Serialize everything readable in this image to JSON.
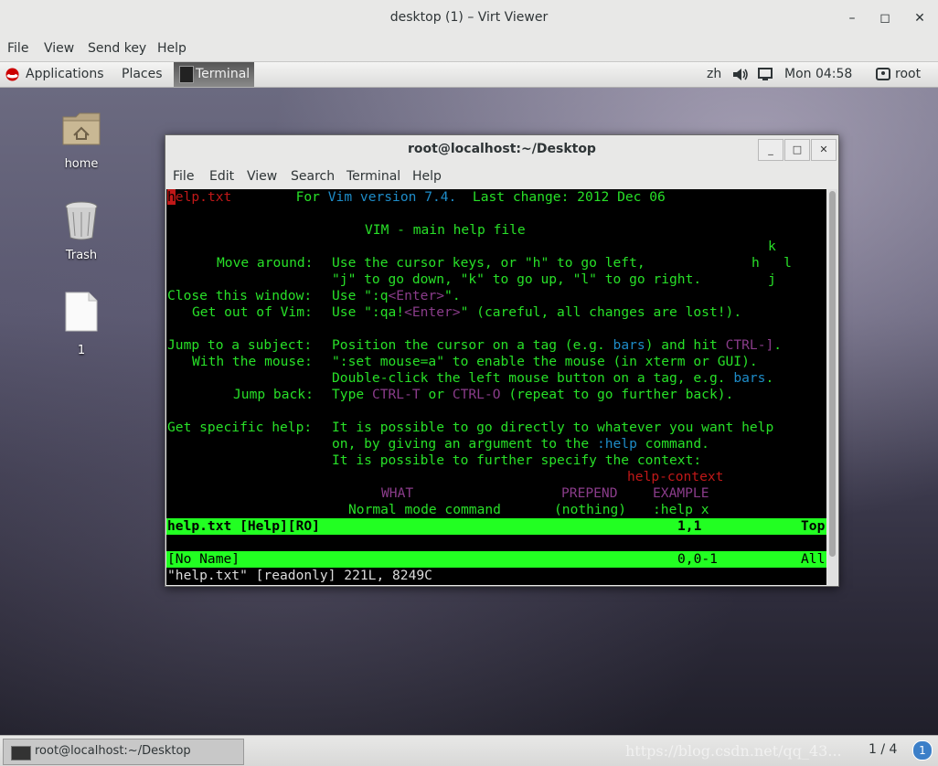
{
  "outer_window": {
    "title": "desktop (1) – Virt Viewer",
    "controls": {
      "minimize": "–",
      "maximize": "◻",
      "close": "✕"
    },
    "menu": [
      "File",
      "View",
      "Send key",
      "Help"
    ]
  },
  "guest_panel": {
    "applications": "Applications",
    "places": "Places",
    "terminal_tab": "Terminal",
    "input_method": "zh",
    "clock": "Mon 04:58",
    "user": "root"
  },
  "desktop_icons": [
    {
      "label": "home",
      "icon": "home-folder-icon"
    },
    {
      "label": "Trash",
      "icon": "trash-icon"
    },
    {
      "label": "1",
      "icon": "file-icon"
    }
  ],
  "terminal": {
    "title": "root@localhost:~/Desktop",
    "menu": [
      "File",
      "Edit",
      "View",
      "Search",
      "Terminal",
      "Help"
    ],
    "lines": {
      "l1_cursor": "h",
      "l1_file": "elp.txt",
      "l1_for": "For ",
      "l1_vim": "Vim version 7.4.",
      "l1_change": "  Last change: 2012 Dec 06",
      "l3": "VIM - main help file",
      "l4_k": "k",
      "l5_label": "Move around:",
      "l5_text": "Use the cursor keys, or \"h\" to go left,",
      "l5_hl": "h   l",
      "l6_text": "\"j\" to go down, \"k\" to go up, \"l\" to go right.",
      "l6_j": "j",
      "l7_label": "Close this window:",
      "l7_a": "Use \":q",
      "l7_enter": "<Enter>",
      "l7_b": "\".",
      "l8_label": "Get out of Vim:",
      "l8_a": "Use \":qa!",
      "l8_enter": "<Enter>",
      "l8_b": "\" (careful, all changes are lost!).",
      "l10_label": "Jump to a subject:",
      "l10_a": "Position the cursor on a tag (e.g. ",
      "l10_bars": "bars",
      "l10_b": ") and hit ",
      "l10_ctrl": "CTRL-]",
      "l10_c": ".",
      "l11_label": "With the mouse:",
      "l11_text": "\":set mouse=a\" to enable the mouse (in xterm or GUI).",
      "l12_a": "Double-click the left mouse button on a tag, e.g. ",
      "l12_bars": "bars",
      "l12_b": ".",
      "l13_label": "Jump back:",
      "l13_a": "Type ",
      "l13_ctrlt": "CTRL-T",
      "l13_b": " or ",
      "l13_ctrlo": "CTRL-O",
      "l13_c": " (repeat to go further back).",
      "l15_label": "Get specific help:",
      "l15_text": "It is possible to go directly to whatever you want help",
      "l16_a": "on, by giving an argument to the ",
      "l16_help": ":help",
      "l16_b": " command.",
      "l17_text": "It is possible to further specify the context:",
      "l18_ctx": "help-context",
      "l19_what": "WHAT",
      "l19_prepend": "PREPEND",
      "l19_example": "EXAMPLE",
      "l20_normal": "Normal mode command",
      "l20_nothing": "(nothing)",
      "l20_help": ":help x"
    },
    "status1": {
      "file": "help.txt [Help][RO]",
      "pos": "1,1",
      "scroll": "Top"
    },
    "status2": {
      "file": "[No Name]",
      "pos": "0,0-1",
      "scroll": "All"
    },
    "message": "\"help.txt\" [readonly] 221L, 8249C"
  },
  "taskbar": {
    "window_item": "root@localhost:~/Desktop",
    "watermark": "https://blog.csdn.net/qq_43...",
    "workspace": "1 / 4",
    "badge": "1"
  },
  "colors": {
    "vim_green": "#28e028",
    "status_bar": "#22ff22",
    "vim_red": "#c01818",
    "vim_blue": "#1e8cc8",
    "vim_purple": "#8a3c8a"
  }
}
